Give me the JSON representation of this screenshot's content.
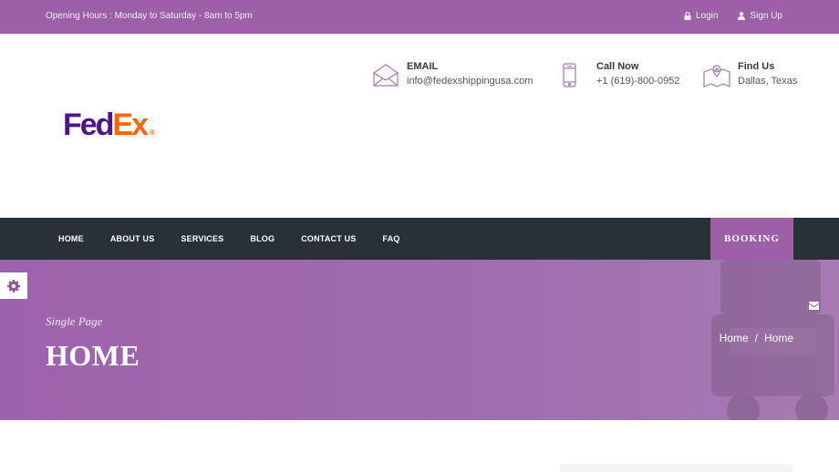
{
  "topbar": {
    "hours": "Opening Hours : Monday to Saturday - 8am to 5pm",
    "login": "Login",
    "signup": "Sign Up"
  },
  "logo": {
    "fed": "Fed",
    "ex": "Ex",
    "reg": "®"
  },
  "contact": {
    "email": {
      "title": "EMAIL",
      "value": "info@fedexshippingusa.com",
      "icon": "envelope-icon"
    },
    "call": {
      "title": "Call Now",
      "value": "+1 (619)-800-0952",
      "icon": "phone-icon"
    },
    "find": {
      "title": "Find Us",
      "value": "Dallas, Texas",
      "icon": "map-icon"
    }
  },
  "nav": {
    "items": [
      "HOME",
      "ABOUT US",
      "SERVICES",
      "BLOG",
      "CONTACT US",
      "FAQ"
    ],
    "booking": "BOOKING"
  },
  "banner": {
    "subtitle": "Single Page",
    "title": "HOME",
    "breadcrumb": [
      "Home",
      "/",
      "Home"
    ]
  },
  "colors": {
    "brand": "#9c5fa8",
    "nav_bg": "#283236",
    "fedex_purple": "#4d148c",
    "fedex_orange": "#ff6600"
  }
}
